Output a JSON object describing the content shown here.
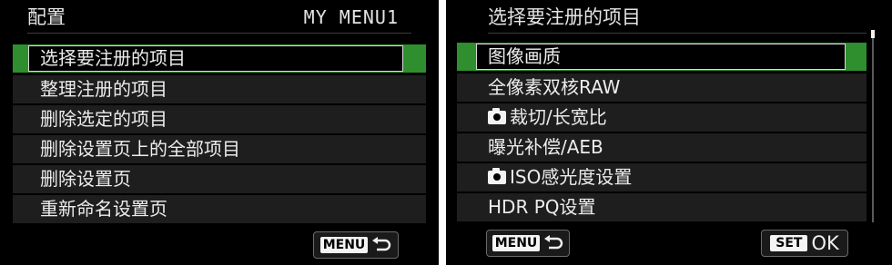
{
  "left": {
    "title": "配置",
    "tag": "MY MENU1",
    "items": [
      {
        "label": "选择要注册的项目"
      },
      {
        "label": "整理注册的项目"
      },
      {
        "label": "删除选定的项目"
      },
      {
        "label": "删除设置页上的全部项目"
      },
      {
        "label": "删除设置页"
      },
      {
        "label": "重新命名设置页"
      }
    ],
    "menu_button": {
      "badge": "MENU",
      "icon": "return-arrow-icon"
    }
  },
  "right": {
    "title": "选择要注册的项目",
    "items": [
      {
        "label": "图像画质"
      },
      {
        "label": "全像素双核RAW"
      },
      {
        "label": "裁切/长宽比",
        "icon": "camera-icon"
      },
      {
        "label": "曝光补偿/AEB"
      },
      {
        "label": "ISO感光度设置",
        "icon": "camera-icon"
      },
      {
        "label": "HDR PQ设置"
      }
    ],
    "menu_button": {
      "badge": "MENU",
      "icon": "return-arrow-icon"
    },
    "ok_button": {
      "badge": "SET",
      "text": "OK"
    }
  },
  "colors": {
    "highlight": "#2f8f2f",
    "background": "#000000",
    "row": "#1e1e1e"
  }
}
